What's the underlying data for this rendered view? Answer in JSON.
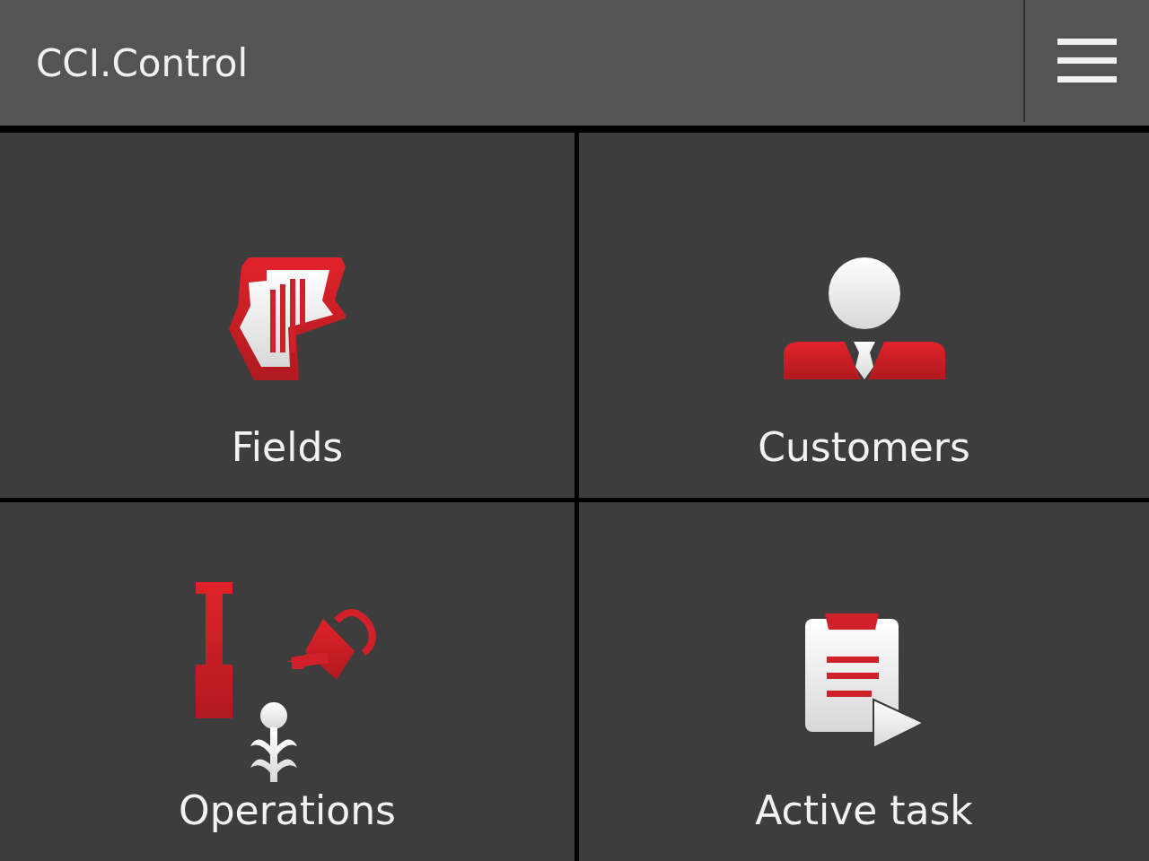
{
  "header": {
    "title": "CCI.Control"
  },
  "tiles": [
    {
      "label": "Fields",
      "kind": "fields"
    },
    {
      "label": "Customers",
      "kind": "customers"
    },
    {
      "label": "Operations",
      "kind": "operations"
    },
    {
      "label": "Active task",
      "kind": "task"
    }
  ]
}
